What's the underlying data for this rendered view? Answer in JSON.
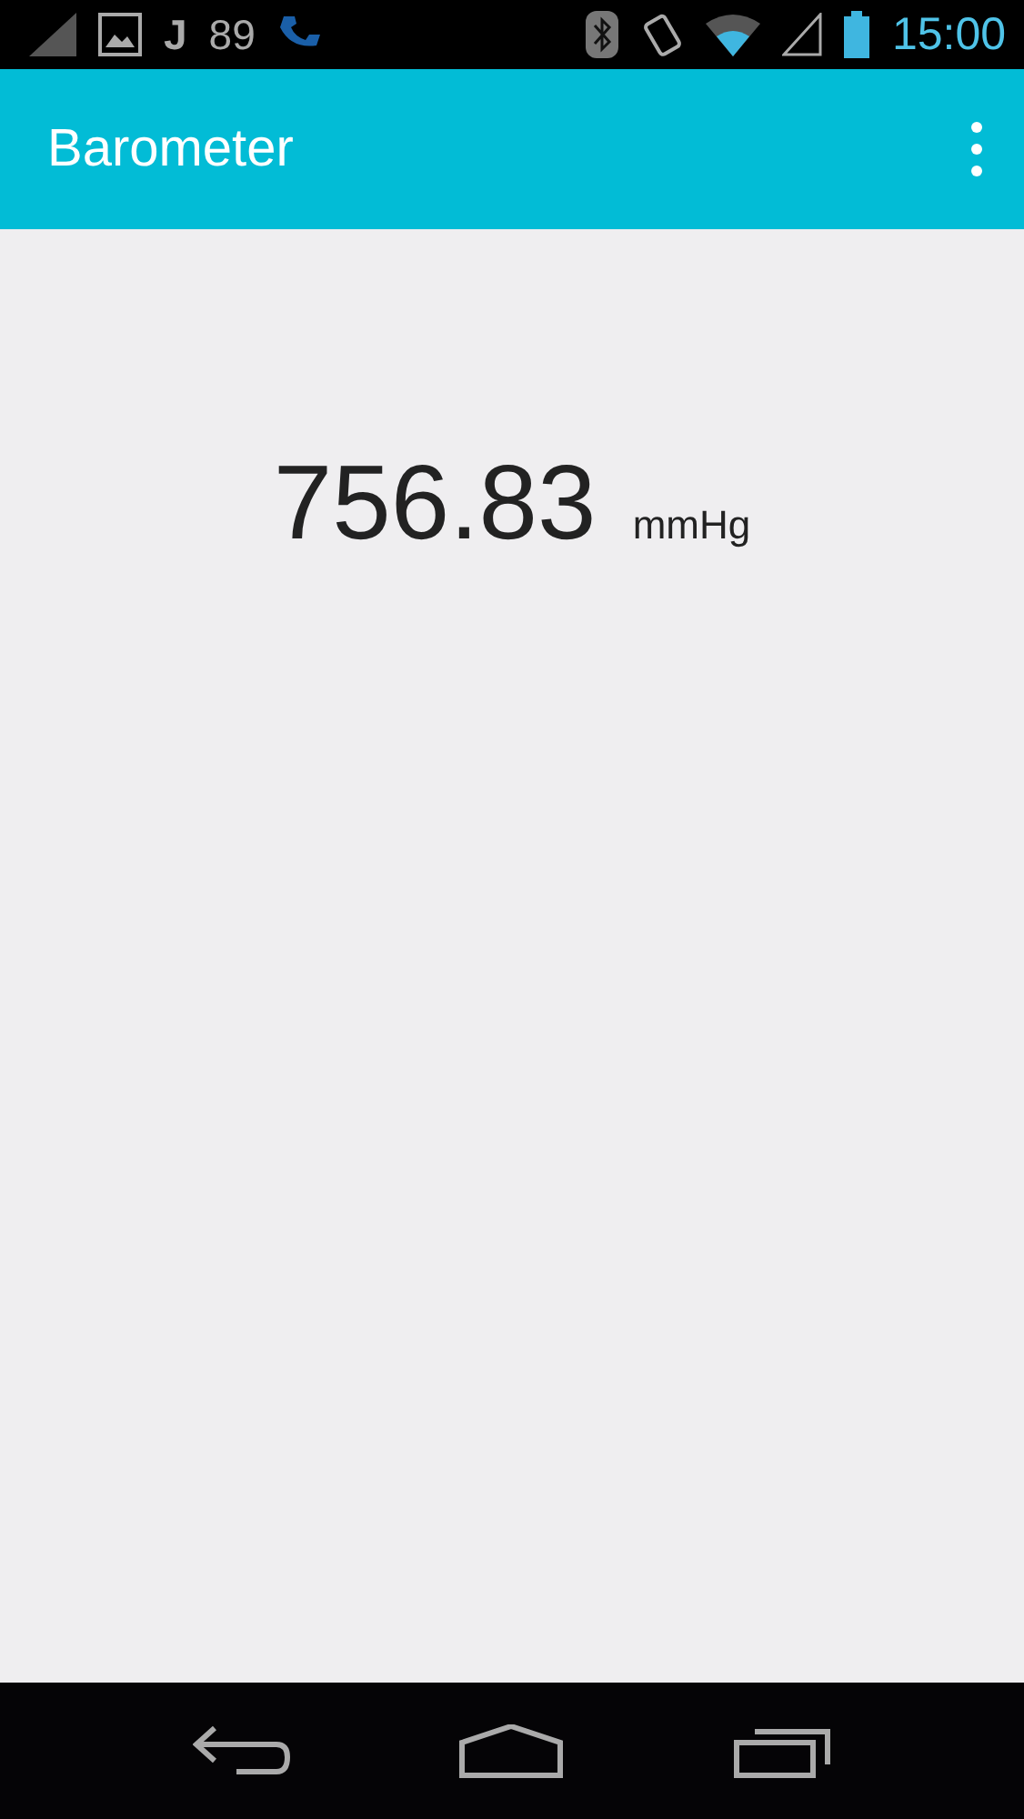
{
  "status_bar": {
    "notification_letter": "J",
    "notification_count": "89",
    "time": "15:00"
  },
  "app_bar": {
    "title": "Barometer"
  },
  "reading": {
    "value": "756.83",
    "unit": "mmHg"
  }
}
